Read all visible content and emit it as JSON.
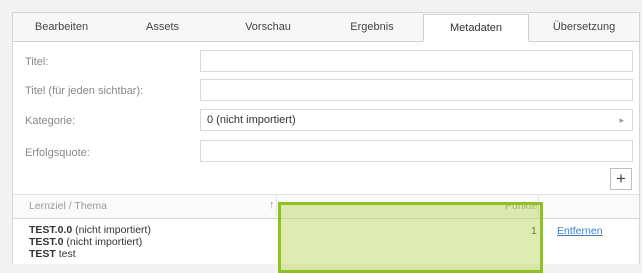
{
  "tabs": [
    {
      "label": "Bearbeiten"
    },
    {
      "label": "Assets"
    },
    {
      "label": "Vorschau"
    },
    {
      "label": "Ergebnis"
    },
    {
      "label": "Metadaten",
      "active": true
    },
    {
      "label": "Übersetzung"
    }
  ],
  "form": {
    "title_label": "Titel:",
    "title_value": "",
    "title_visible_label": "Titel (für jeden sichtbar):",
    "title_visible_value": "",
    "category_label": "Kategorie:",
    "category_value": "0 (nicht importiert)",
    "success_label": "Erfolgsquote:",
    "success_value": ""
  },
  "add_button_label": "+",
  "table": {
    "headers": {
      "topic": "Lernziel / Thema",
      "points": "Punkte"
    },
    "rows": [
      {
        "lines": [
          {
            "bold": "TEST.0.0",
            "rest": " (nicht importiert)"
          },
          {
            "bold": "TEST.0",
            "rest": " (nicht importiert)"
          },
          {
            "bold": "TEST",
            "rest": " test"
          }
        ],
        "points": "1",
        "action": "Entfernen"
      }
    ]
  },
  "colors": {
    "accent": "#8fc11f",
    "link": "#3a7fc1"
  }
}
